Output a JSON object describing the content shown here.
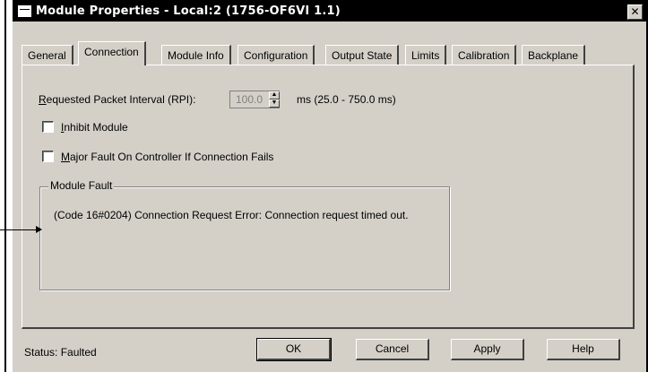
{
  "window": {
    "title": "Module Properties - Local:2 (1756-OF6VI 1.1)",
    "close_glyph": "✕"
  },
  "tabs": [
    {
      "label": "General"
    },
    {
      "label": "Connection"
    },
    {
      "label": "Module Info"
    },
    {
      "label": "Configuration"
    },
    {
      "label": "Output State"
    },
    {
      "label": "Limits"
    },
    {
      "label": "Calibration"
    },
    {
      "label": "Backplane"
    }
  ],
  "active_tab": "Connection",
  "connection": {
    "rpi_label_accel": "R",
    "rpi_label_rest": "equested Packet Interval (RPI):",
    "rpi_value": "100.0",
    "rpi_units": "ms  (25.0 - 750.0 ms)",
    "inhibit_accel": "I",
    "inhibit_rest": "nhibit Module",
    "inhibit_checked": false,
    "major_fault_accel": "M",
    "major_fault_rest": "ajor Fault On Controller If Connection Fails",
    "major_fault_checked": false,
    "module_fault_title": "Module Fault",
    "module_fault_text": "(Code 16#0204) Connection Request Error: Connection request timed out."
  },
  "status": {
    "text": "Status:  Faulted"
  },
  "buttons": {
    "ok": "OK",
    "cancel": "Cancel",
    "apply": "Apply",
    "help": "Help"
  }
}
